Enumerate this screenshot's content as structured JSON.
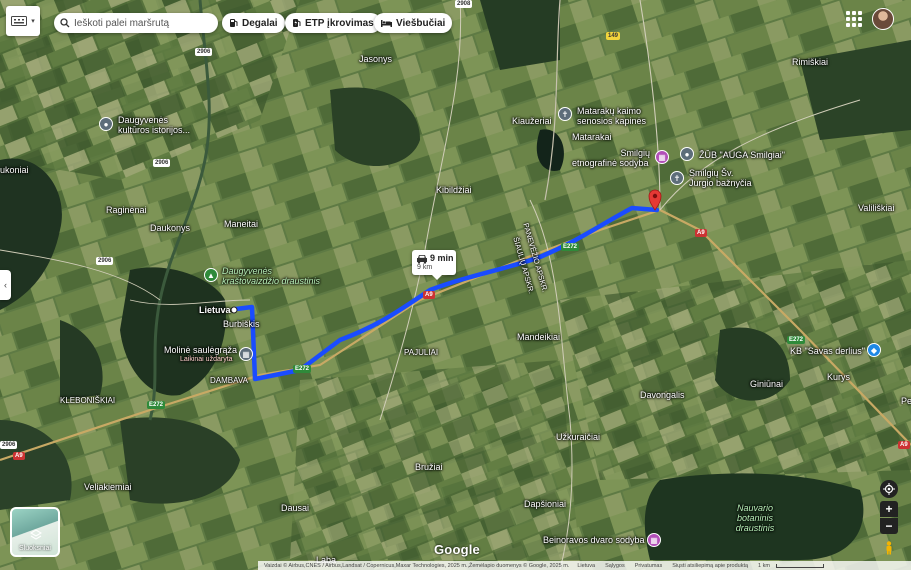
{
  "search": {
    "placeholder": "Ieškoti palei maršrutą"
  },
  "chips": [
    {
      "label": "Degalai",
      "icon": "fuel-icon"
    },
    {
      "label": "ETP įkrovimas",
      "icon": "ev-charger-icon"
    },
    {
      "label": "Viešbučiai",
      "icon": "bed-icon"
    }
  ],
  "route": {
    "time": "9 min",
    "distance": "9 km",
    "color": "#1a4cff"
  },
  "places": {
    "jasonys": "Jasonys",
    "rimiskiai": "Rimiškiai",
    "daugyvenes_museum_1": "Daugyvenės",
    "daugyvenes_museum_2": "kultūros istorijos...",
    "matarakai_cemetery_1": "Matarakų kaimo",
    "matarakai_cemetery_2": "senosios kapinės",
    "kiauzeriai": "Kiaužeriai",
    "matarakai": "Matarakai",
    "ukoniai": "ukoniai",
    "smilgiu_etno_1": "Smilgių",
    "smilgiu_etno_2": "etnografinė sodyba",
    "zub_auga": "ŽŪB \"AUGA Smilgiai\"",
    "smilgiu_church_1": "Smilgių Šv.",
    "smilgiu_church_2": "Jurgio bažnyčia",
    "kibildziai": "Kibildžiai",
    "raginenai": "Raginėnai",
    "daukonys": "Daukonys",
    "maneitai": "Maneitai",
    "valiliskiai": "Valiliškiai",
    "panevezio_1": "PANEVĖŽIO APSKR.",
    "panevezio_2": "ŠIAULIŲ APSKR.",
    "daugyvenes_park_1": "Daugyvenės",
    "daugyvenes_park_2": "kraštovaizdžio draustinis",
    "lietuva": "Lietuva",
    "burbiskis": "Burbiškis",
    "pajuliai": "PAJULIAI",
    "mandeikiai": "Mandeikiai",
    "moline_1": "Molinė saulėgrąža",
    "moline_2": "Laikinai uždaryta",
    "dambava": "DAMBAVA",
    "savas_derlius": "KB \"Savas derlius\"",
    "kurys": "Kurys",
    "giniunai": "Giniūnai",
    "klebonishkiai": "KLEBONIŠKIAI",
    "davongalis": "Davongalis",
    "uzkuraiciai": "Užkuraičiai",
    "pe": "Pe",
    "veliakiemiai": "Veliakiemiai",
    "bruziai": "Bružiai",
    "dausai": "Dausai",
    "dapsioniai": "Dapšioniai",
    "nauvario_1": "Nauvario",
    "nauvario_2": "botaninis",
    "nauvario_3": "draustinis",
    "beinoravos": "Beinoravos dvaro sodyba",
    "laba": "Laba"
  },
  "road_shields": {
    "r2908_a": "2908",
    "r2906_a": "2906",
    "r2906_b": "2906",
    "r2906_c": "2906",
    "e272_a": "E272",
    "e272_b": "E272",
    "e272_c": "E272",
    "e272_d": "E272",
    "a9_a": "A9",
    "a9_b": "A9",
    "a9_c": "A9",
    "a9_d": "A9",
    "a9_e": "A9",
    "a9_f": "A9",
    "r149": "149"
  },
  "layers": {
    "label": "Sluoksniai"
  },
  "logo": "Google",
  "footer": {
    "attribution": "Vaizdai © Airbus,CNES / Airbus,Landsat / Copernicus,Maxar Technologies, 2025 m.,Žemėlapio duomenys © Google, 2025 m.",
    "country": "Lietuva",
    "terms": "Sąlygos",
    "privacy": "Privatumas",
    "feedback": "Siųsti atsiliepimą apie produktą",
    "scale": "1 km"
  }
}
